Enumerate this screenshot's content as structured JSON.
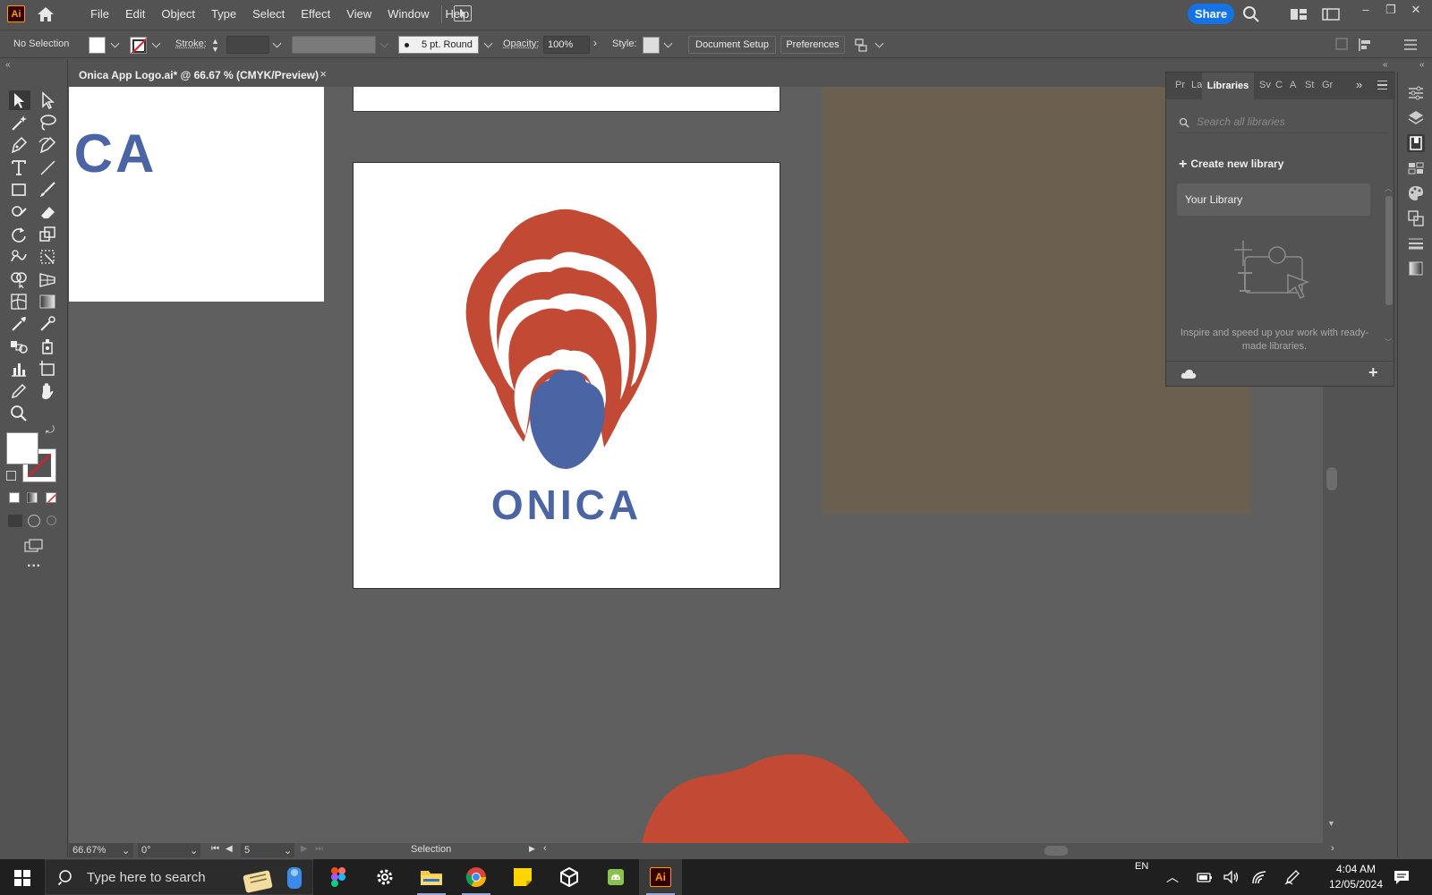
{
  "app": {
    "logo_text": "Ai",
    "menu": [
      "File",
      "Edit",
      "Object",
      "Type",
      "Select",
      "Effect",
      "View",
      "Window",
      "Help"
    ],
    "share_label": "Share"
  },
  "controlbar": {
    "selection_label": "No Selection",
    "stroke_label": "Stroke:",
    "brush_label": "5 pt. Round",
    "opacity_label": "Opacity:",
    "opacity_value": "100%",
    "style_label": "Style:",
    "document_setup_label": "Document Setup",
    "preferences_label": "Preferences"
  },
  "document": {
    "tab_title": "Onica App Logo.ai* @ 66.67 % (CMYK/Preview)",
    "close_glyph": "×",
    "left_artboard_text": "ICA",
    "main_logo_text": "ONICA"
  },
  "colors": {
    "brand_red": "#c24a35",
    "brand_blue": "#4a64a4",
    "tan_artboard": "#6b6050",
    "accent_blue": "#1473e6"
  },
  "libraries": {
    "tabs": [
      "Pr",
      "La",
      "Libraries",
      "Sv",
      "C",
      "A",
      "St",
      "Gr"
    ],
    "search_placeholder": "Search all libraries",
    "create_label": "Create new library",
    "your_library_label": "Your Library",
    "inspire_text": "Inspire and speed up your work with ready-made libraries."
  },
  "statusbar": {
    "zoom": "66.67%",
    "rotation": "0°",
    "artboard_number": "5",
    "tool_name": "Selection"
  },
  "taskbar": {
    "search_placeholder": "Type here to search",
    "language": "EN",
    "time": "4:04 AM",
    "date": "12/05/2024"
  },
  "icons": [
    "home-icon",
    "search-icon",
    "arrange-icon",
    "window-icon",
    "minimize-icon",
    "maximize-icon",
    "close-icon",
    "selection-tool-icon",
    "direct-selection-icon",
    "magic-wand-icon",
    "lasso-icon",
    "pen-icon",
    "curvature-icon",
    "type-icon",
    "line-icon",
    "rectangle-icon",
    "paintbrush-icon",
    "shaper-icon",
    "eraser-icon",
    "rotate-icon",
    "scale-icon",
    "warp-icon",
    "free-transform-icon",
    "shape-builder-icon",
    "perspective-icon",
    "mesh-icon",
    "gradient-icon",
    "eyedropper-icon",
    "blend-icon",
    "symbol-icon",
    "graph-icon",
    "artboard-icon",
    "slice-icon",
    "hand-icon",
    "zoom-icon",
    "cloud-icon",
    "plus-icon"
  ]
}
